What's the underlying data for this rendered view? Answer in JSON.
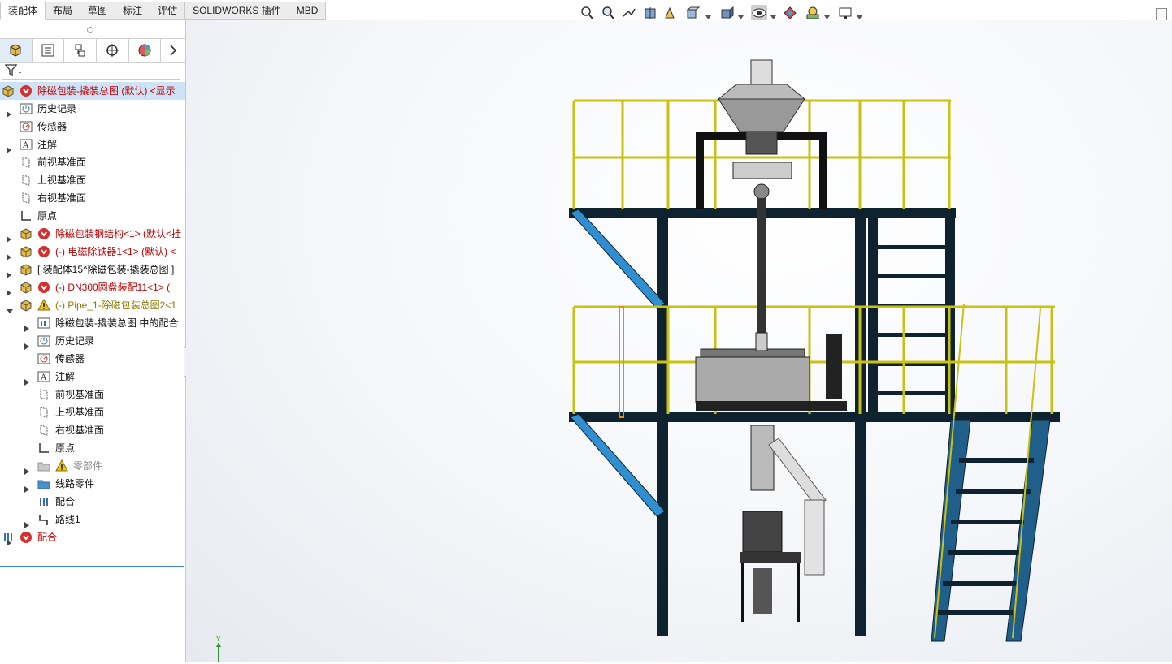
{
  "command_tabs": [
    "装配体",
    "布局",
    "草图",
    "标注",
    "评估",
    "SOLIDWORKS 插件",
    "MBD"
  ],
  "active_tab": "装配体",
  "view_toolbar": {
    "icons": [
      "zoom-to-fit-icon",
      "zoom-to-area-icon",
      "previous-view-icon",
      "section-view-icon",
      "dynamic-annotation-icon",
      "view-orientation-icon",
      "display-style-icon",
      "hide-show-items-icon",
      "edit-appearance-icon",
      "apply-scene-icon",
      "view-settings-icon"
    ]
  },
  "panel_tabs": [
    "featuremanager-icon",
    "propertymanager-icon",
    "configurationmanager-icon",
    "dimxpert-icon",
    "displaymanager-icon",
    "more-icon"
  ],
  "tree": [
    {
      "label": "除磁包装-撬装总图 (默认) <显示",
      "level": 0,
      "icon": "assembly-icon",
      "status": "error",
      "color": "red",
      "expand": "none",
      "selected": true
    },
    {
      "label": "历史记录",
      "level": 1,
      "icon": "history-icon",
      "expand": "collapsed"
    },
    {
      "label": "传感器",
      "level": 1,
      "icon": "sensor-icon",
      "expand": "none"
    },
    {
      "label": "注解",
      "level": 1,
      "icon": "annotation-icon",
      "expand": "collapsed"
    },
    {
      "label": "前视基准面",
      "level": 1,
      "icon": "plane-icon",
      "expand": "none"
    },
    {
      "label": "上视基准面",
      "level": 1,
      "icon": "plane-icon",
      "expand": "none"
    },
    {
      "label": "右视基准面",
      "level": 1,
      "icon": "plane-icon",
      "expand": "none"
    },
    {
      "label": "原点",
      "level": 1,
      "icon": "origin-icon",
      "expand": "none"
    },
    {
      "label": "除磁包装钢结构<1> (默认<挂",
      "level": 1,
      "icon": "assembly-icon",
      "status": "error",
      "color": "red",
      "expand": "collapsed"
    },
    {
      "label": "(-) 电磁除铁器1<1> (默认) <",
      "level": 1,
      "icon": "assembly-icon",
      "status": "error",
      "color": "red",
      "expand": "collapsed"
    },
    {
      "label": "[ 装配体15^除磁包装-撬装总图 ]",
      "level": 1,
      "icon": "assembly-icon",
      "expand": "collapsed"
    },
    {
      "label": "(-) DN300圆盘装配11<1> (",
      "level": 1,
      "icon": "assembly-icon",
      "status": "error",
      "color": "red",
      "expand": "collapsed"
    },
    {
      "label": "(-) Pipe_1-除磁包装总图2<1",
      "level": 1,
      "icon": "assembly-icon",
      "status": "warning",
      "color": "olive",
      "expand": "expanded"
    },
    {
      "label": "除磁包装-撬装总图 中的配合",
      "level": 2,
      "icon": "mates-folder-icon",
      "expand": "collapsed"
    },
    {
      "label": "历史记录",
      "level": 2,
      "icon": "history-icon",
      "expand": "collapsed"
    },
    {
      "label": "传感器",
      "level": 2,
      "icon": "sensor-icon",
      "expand": "none"
    },
    {
      "label": "注解",
      "level": 2,
      "icon": "annotation-icon",
      "expand": "collapsed"
    },
    {
      "label": "前视基准面",
      "level": 2,
      "icon": "plane-icon",
      "expand": "none"
    },
    {
      "label": "上视基准面",
      "level": 2,
      "icon": "plane-icon",
      "expand": "none"
    },
    {
      "label": "右视基准面",
      "level": 2,
      "icon": "plane-icon",
      "expand": "none"
    },
    {
      "label": "原点",
      "level": 2,
      "icon": "origin-icon",
      "expand": "none"
    },
    {
      "label": "零部件",
      "level": 2,
      "icon": "folder-grey-icon",
      "status": "warning",
      "color": "grey",
      "expand": "collapsed"
    },
    {
      "label": "线路零件",
      "level": 2,
      "icon": "folder-blue-icon",
      "expand": "collapsed"
    },
    {
      "label": "配合",
      "level": 2,
      "icon": "mates-icon",
      "expand": "none"
    },
    {
      "label": "路线1",
      "level": 2,
      "icon": "route-icon",
      "expand": "collapsed"
    },
    {
      "label": "配合",
      "level": 0,
      "icon": "mates-icon",
      "status": "error",
      "color": "red",
      "expand": "collapsed"
    }
  ],
  "triad_label": "Y",
  "colors": {
    "steel": "#0e2230",
    "railing": "#c9c212",
    "brace": "#2f8fd0",
    "ladder": "#1f5f8a"
  }
}
